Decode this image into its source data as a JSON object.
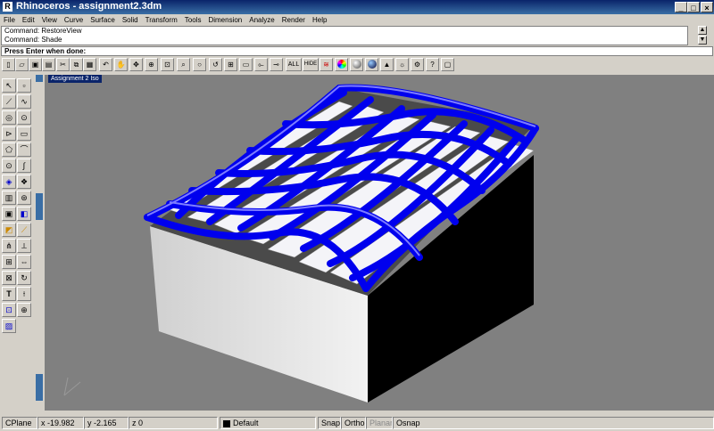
{
  "window": {
    "title": "Rhinoceros - assignment2.3dm",
    "app_icon": "rhino-icon",
    "controls": [
      "_",
      "□",
      "×"
    ]
  },
  "menu": [
    "File",
    "Edit",
    "View",
    "Curve",
    "Surface",
    "Solid",
    "Transform",
    "Tools",
    "Dimension",
    "Analyze",
    "Render",
    "Help"
  ],
  "command_history": [
    "Command: RestoreView",
    "Command: Shade"
  ],
  "prompt": "Press Enter when done:",
  "toolbar_labels": {
    "all": "ALL",
    "hide": "HIDE"
  },
  "viewport": {
    "title": "Assignment 2 Iso"
  },
  "status": {
    "cplane": "CPlane",
    "x": "x -19.982",
    "y": "y -2.165",
    "z": "z 0",
    "layer": "Default",
    "snap": "Snap",
    "ortho": "Ortho",
    "planar": "Planar",
    "osnap": "Osnap"
  },
  "colors": {
    "title_bar": "#0a246a",
    "surface_tubes": "#0000ee",
    "viewport_bg": "#808080"
  }
}
